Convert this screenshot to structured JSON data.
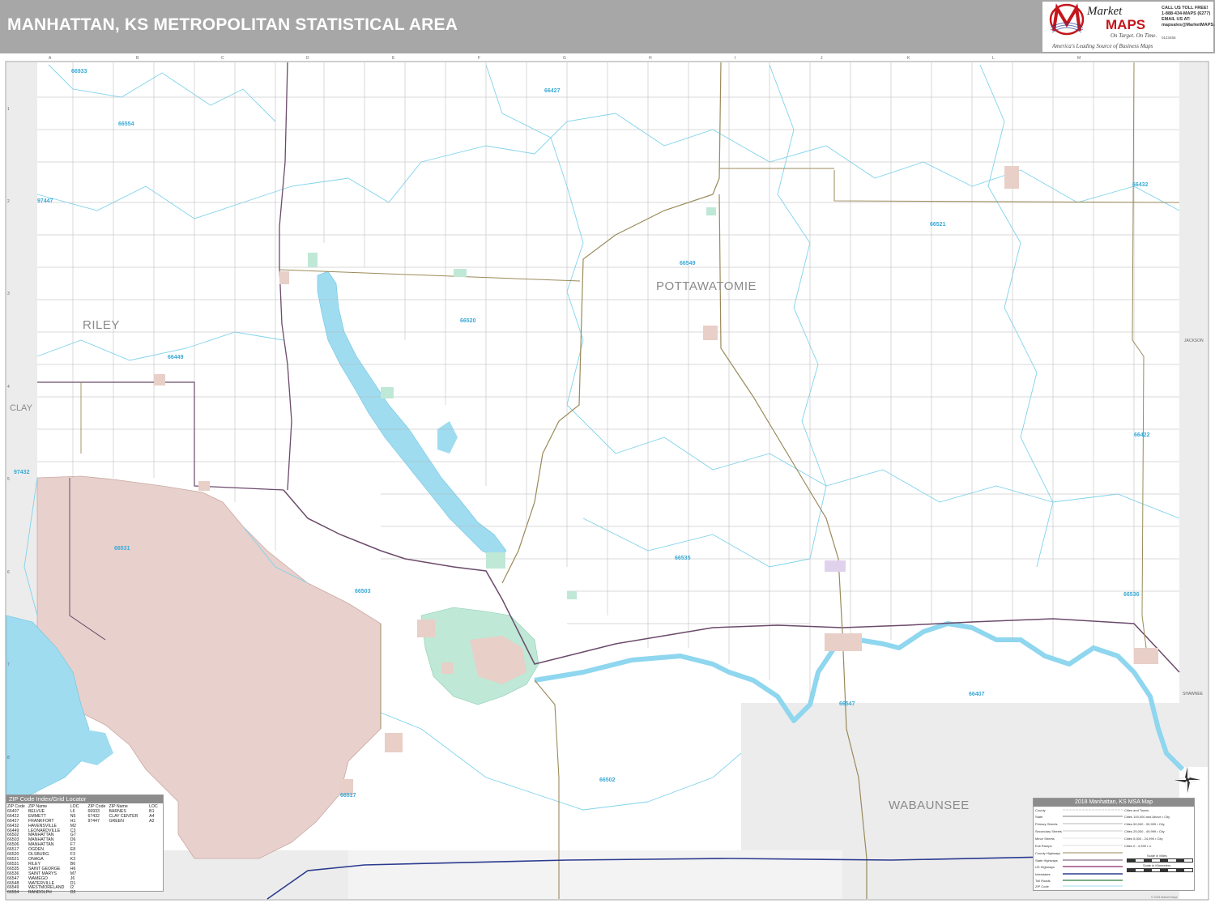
{
  "title": "MANHATTAN, KS METROPOLITAN STATISTICAL AREA",
  "logo": {
    "brand_market": "Market",
    "brand_maps": "MAPS",
    "tagline": "On Target.  On Time.",
    "subtitle": "America's Leading Source of Business Maps",
    "contact": [
      "CALL US TOLL FREE!",
      "1-888-434-MAPS (6277)",
      "EMAIL US AT:",
      "mapsales@MarketMAPS.com"
    ],
    "code": "0123456",
    "colors": {
      "brand_red": "#c4161c",
      "header_gray": "#a7a7a7"
    }
  },
  "grid": {
    "columns": [
      "A",
      "B",
      "C",
      "D",
      "E",
      "F",
      "G",
      "H",
      "I",
      "J",
      "K",
      "L",
      "M"
    ],
    "rows": [
      "1",
      "2",
      "3",
      "4",
      "5",
      "6",
      "7",
      "8",
      "9"
    ]
  },
  "counties": {
    "riley": "RILEY",
    "pottawatomie": "POTTAWATOMIE",
    "clay": "CLAY",
    "wabaunsee": "WABAUNSEE",
    "jackson": "JACKSON",
    "shawnee": "SHAWNEE"
  },
  "zip_labels": [
    "66933",
    "66427",
    "66554",
    "97447",
    "66432",
    "66521",
    "66549",
    "66520",
    "66449",
    "66422",
    "97432",
    "66531",
    "66535",
    "66503",
    "66536",
    "66407",
    "66547",
    "66502",
    "66517"
  ],
  "zip_index": {
    "title": "ZIP Code Index/Grid Locator",
    "headers": [
      "ZIP Code",
      "ZIP Name",
      "LOC",
      "ZIP Code",
      "ZIP Name",
      "LOC"
    ],
    "rows_left": [
      [
        "66407",
        "BELVUE",
        "L6"
      ],
      [
        "66422",
        "EMMETT",
        "N5"
      ],
      [
        "66427",
        "FRANKFORT",
        "H1"
      ],
      [
        "66432",
        "HAVENSVILLE",
        "M2"
      ],
      [
        "66449",
        "LEONARDVILLE",
        "C3"
      ],
      [
        "66502",
        "MANHATTAN",
        "G7"
      ],
      [
        "66503",
        "MANHATTAN",
        "D6"
      ],
      [
        "66506",
        "MANHATTAN",
        "F7"
      ],
      [
        "66517",
        "OGDEN",
        "E8"
      ],
      [
        "66520",
        "OLSBURG",
        "F3"
      ],
      [
        "66521",
        "ONAGA",
        "K3"
      ],
      [
        "66531",
        "RILEY",
        "B6"
      ],
      [
        "66535",
        "SAINT GEORGE",
        "H6"
      ],
      [
        "66536",
        "SAINT MARYS",
        "M7"
      ],
      [
        "66547",
        "WAMEGO",
        "J6"
      ],
      [
        "66548",
        "WATERVILLE",
        "D1"
      ],
      [
        "66549",
        "WESTMORELAND",
        "I2"
      ],
      [
        "66554",
        "RANDOLPH",
        "D2"
      ]
    ],
    "rows_right": [
      [
        "66933",
        "BARNES",
        "B1"
      ],
      [
        "67432",
        "CLAY CENTER",
        "A4"
      ],
      [
        "97447",
        "GREEN",
        "A2"
      ]
    ]
  },
  "legend": {
    "title": "2018 Manhattan, KS MSA Map",
    "items": [
      "County",
      "State",
      "Primary Streets",
      "Secondary Streets",
      "Minor Streets",
      "Exit Ramps",
      "County Highways",
      "State Highways",
      "US Highways",
      "Interstates",
      "Toll Roads",
      "ZIP Code"
    ],
    "cities_header": "Cities and Towns",
    "cities": [
      "Cities 100,000 and Above",
      "Cities 50,000 - 99,999",
      "Cities 25,000 - 49,999",
      "Cities 5,000 - 24,999",
      "Cities 0 - 4,999"
    ],
    "city_marks": [
      "• City",
      "• City",
      "• City",
      "• City",
      "• ••"
    ],
    "scale_miles": "Scale in Miles",
    "scale_km": "Scale in Kilometers"
  },
  "copyright": "© 2018 Market Maps"
}
